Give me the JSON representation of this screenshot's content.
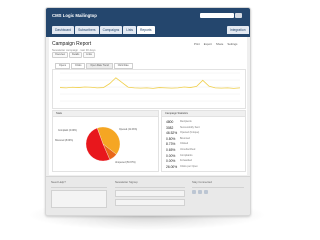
{
  "header": {
    "app_title": "CMS Logic Mailingtop",
    "nav_tabs": [
      {
        "label": "Dashboard"
      },
      {
        "label": "Subscribers"
      },
      {
        "label": "Campaigns"
      },
      {
        "label": "Lists"
      },
      {
        "label": "Reports"
      }
    ],
    "right_tab": "Integration"
  },
  "page": {
    "title": "Campaign Report",
    "subtitle": "Newsletter campaign · last 30 days",
    "actions": [
      "Print",
      "Export",
      "Share",
      "Settings"
    ],
    "controls": [
      "Overview",
      "Details",
      "Links"
    ],
    "chart_tabs": [
      "Opens",
      "Clicks",
      "Open Rate Trend",
      "Click Rate"
    ]
  },
  "line_chart": {
    "title": "",
    "y_ticks": [
      "",
      "",
      "",
      "",
      ""
    ],
    "values": [
      0.48,
      0.47,
      0.49,
      0.48,
      0.5,
      0.49,
      0.47,
      0.48,
      0.62,
      0.83,
      0.66,
      0.49,
      0.47,
      0.46,
      0.47,
      0.45,
      0.48,
      0.47,
      0.46,
      0.47,
      0.5,
      0.48,
      0.52,
      0.74,
      0.53,
      0.47,
      0.46,
      0.47,
      0.45,
      0.47
    ],
    "color": "#f0cf4a"
  },
  "left_panel": {
    "title": "Stats",
    "pie": [
      {
        "label": "Complaint (0.00%)",
        "value": 0.1
      },
      {
        "label": "Opened (41.03%)",
        "value": 41
      },
      {
        "label": "Bounced (8.00%)",
        "value": 8
      },
      {
        "label": "Unopened (50.97%)",
        "value": 51
      }
    ],
    "pie_colors": [
      "#ffe066",
      "#f5a623",
      "#e8671a",
      "#e8171c"
    ]
  },
  "right_panel": {
    "title": "Campaign Statistics",
    "stats": [
      {
        "value": "4800",
        "label": "Recipients"
      },
      {
        "value": "3082",
        "label": "Successfully Sent"
      },
      {
        "value": "46.52%",
        "label": "Opened (Unique)"
      },
      {
        "value": "0.80%",
        "label": "Bounced"
      },
      {
        "value": "8.73%",
        "label": "Clicked"
      },
      {
        "value": "0.65%",
        "label": "Unsubscribed"
      },
      {
        "value": "0.00%",
        "label": "Complaints"
      },
      {
        "value": "0.00%",
        "label": "Forwarded"
      },
      {
        "value": "26.00%",
        "label": "Clicks per Open"
      }
    ]
  },
  "footer": {
    "col1_title": "Need Help?",
    "col2_title": "Newsletter Signup",
    "col3_title": "Stay Connected"
  },
  "colors": {
    "header": "#24466d",
    "accent": "#f0cf4a"
  }
}
